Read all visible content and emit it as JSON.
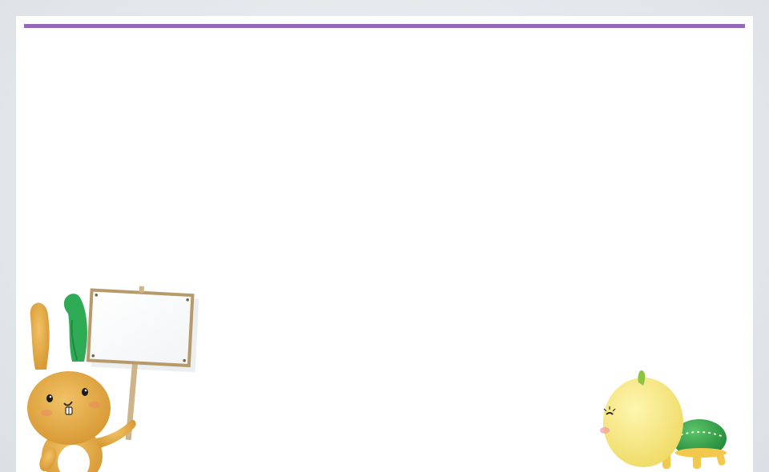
{
  "slide": {
    "accent_color": "#9467bd",
    "background_color": "#ffffff",
    "frame_color": "#e4e8ec"
  },
  "mascots": {
    "left": {
      "icon": "rabbit-mascot-holding-blank-sign-icon",
      "sign_text": ""
    },
    "right": {
      "icon": "lemon-turtle-mascot-icon"
    }
  }
}
